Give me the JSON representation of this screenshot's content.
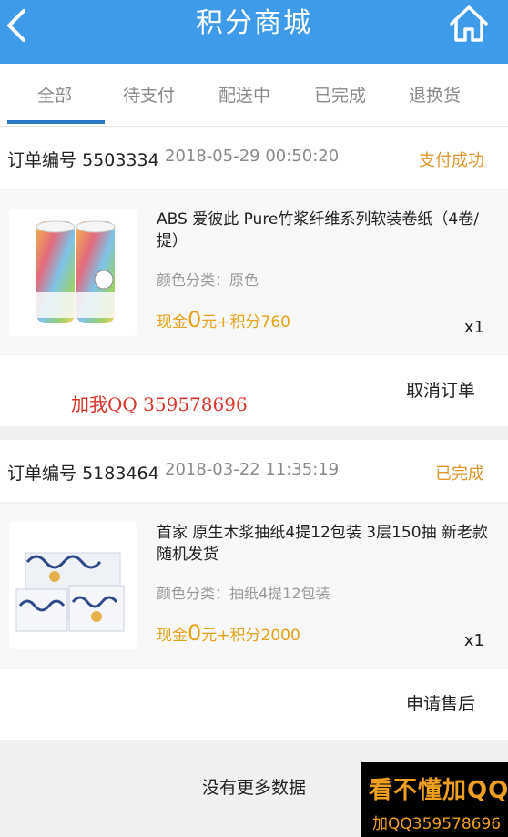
{
  "header": {
    "title": "积分商城"
  },
  "tabs": [
    {
      "label": "全部"
    },
    {
      "label": "待支付"
    },
    {
      "label": "配送中"
    },
    {
      "label": "已完成"
    },
    {
      "label": "退换货"
    }
  ],
  "orders": [
    {
      "label": "订单编号",
      "number": "5503334",
      "datetime": "2018-05-29 00:50:20",
      "status": "支付成功",
      "product": {
        "title": "ABS 爱彼此 Pure竹浆纤维系列软装卷纸（4卷/提）",
        "variant": "颜色分类：原色",
        "price_prefix": "现金",
        "price_cash": "0",
        "price_suffix": "元+积分760",
        "qty": "x1"
      },
      "action": "取消订单"
    },
    {
      "label": "订单编号",
      "number": "5183464",
      "datetime": "2018-03-22 11:35:19",
      "status": "已完成",
      "product": {
        "title": "首家 原生木浆抽纸4提12包装 3层150抽 新老款随机发货",
        "variant": "颜色分类：抽纸4提12包装",
        "price_prefix": "现金",
        "price_cash": "0",
        "price_suffix": "元+积分2000",
        "qty": "x1"
      },
      "action": "申请售后"
    }
  ],
  "footer": {
    "no_more": "没有更多数据"
  },
  "overlays": {
    "red_text": "加我QQ  359578696",
    "promo_line1": "看不懂加QQ",
    "promo_line2": "加QQ359578696"
  },
  "colors": {
    "header_bg": "#3d9be9",
    "accent_status": "#e0952a",
    "price": "#e6a21a",
    "tab_indicator": "#2b78c8"
  }
}
